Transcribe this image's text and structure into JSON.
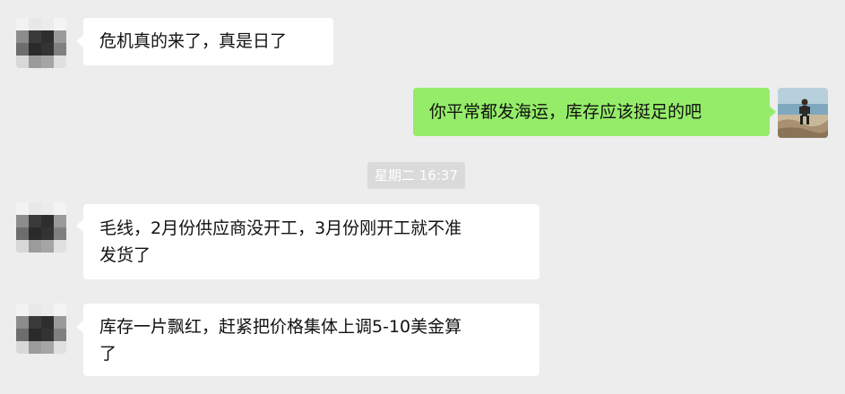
{
  "messages": [
    {
      "side": "left",
      "text": "危机真的来了，真是日了"
    },
    {
      "side": "right",
      "text": "你平常都发海运，库存应该挺足的吧"
    },
    {
      "side": "left",
      "text_line1": "毛线，2月份供应商没开工，3月份刚开工就不准",
      "text_line2": "发货了"
    },
    {
      "side": "left",
      "text_line1": "库存一片飘红，赶紧把价格集体上调5-10美金算",
      "text_line2": "了"
    }
  ],
  "timestamp": "星期二 16:37",
  "colors": {
    "background": "#ededed",
    "incoming_bubble": "#ffffff",
    "outgoing_bubble": "#95ec69",
    "timestamp_bg": "#dadada"
  },
  "icons": {
    "contact_avatar": "pixelated-avatar",
    "self_avatar": "photo-avatar"
  }
}
